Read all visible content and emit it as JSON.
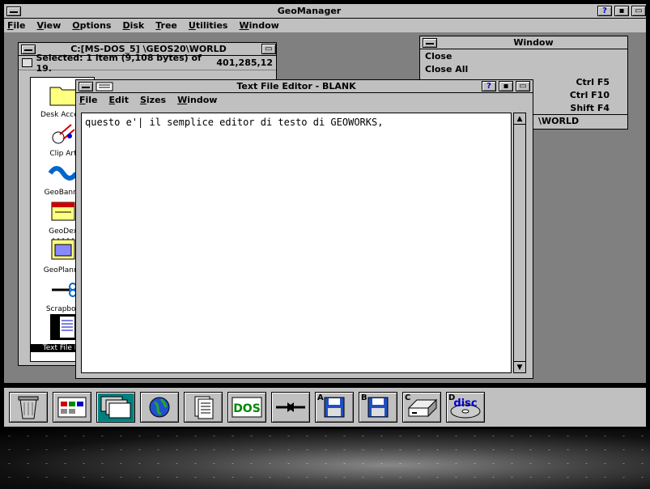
{
  "main": {
    "title": "GeoManager",
    "menu": [
      "File",
      "View",
      "Options",
      "Disk",
      "Tree",
      "Utilities",
      "Window"
    ]
  },
  "folder": {
    "path": "C:[MS-DOS_5] \\GEOS20\\WORLD",
    "status": "Selected: 1 item (9,108 bytes) of 19.",
    "free": "401,285,12",
    "items": [
      {
        "label": "Desk Access",
        "icon": "folder-icon"
      },
      {
        "label": "Clip Art",
        "icon": "clip-art-icon"
      },
      {
        "label": "GeoBanne",
        "icon": "geobanner-icon"
      },
      {
        "label": "GeoDex",
        "icon": "geodex-icon"
      },
      {
        "label": "GeoPlanne",
        "icon": "geoplanner-icon"
      },
      {
        "label": "Scrapboo",
        "icon": "scrapbook-icon"
      },
      {
        "label": "Text File Ed",
        "icon": "text-file-editor-icon"
      }
    ]
  },
  "window_menu": {
    "title": "Window",
    "items": [
      {
        "label": "Close",
        "key": ""
      },
      {
        "label": "Close All",
        "key": ""
      },
      {
        "label": "",
        "key": "Ctrl F5"
      },
      {
        "label": "",
        "key": "Ctrl F10"
      },
      {
        "label": "",
        "key": "Shift F4"
      },
      {
        "label": "\\WORLD",
        "key": ""
      }
    ]
  },
  "editor": {
    "title": "Text File Editor - BLANK",
    "menu": [
      "File",
      "Edit",
      "Sizes",
      "Window"
    ],
    "text": "questo e'| il semplice editor di testo di GEOWORKS,"
  },
  "taskbar": {
    "items": [
      {
        "name": "wastebasket-icon",
        "letter": ""
      },
      {
        "name": "geomanager-icon",
        "letter": ""
      },
      {
        "name": "task-switcher-icon",
        "letter": ""
      },
      {
        "name": "globe-icon",
        "letter": ""
      },
      {
        "name": "documents-icon",
        "letter": ""
      },
      {
        "name": "dos-icon",
        "letter": "",
        "text": "DOS"
      },
      {
        "name": "transfer-icon",
        "letter": ""
      },
      {
        "name": "drive-a-icon",
        "letter": "A"
      },
      {
        "name": "drive-b-icon",
        "letter": "B"
      },
      {
        "name": "drive-c-icon",
        "letter": "C"
      },
      {
        "name": "drive-d-icon",
        "letter": "D",
        "text": "disc"
      }
    ]
  },
  "colors": {
    "desktop": "#808080",
    "chrome": "#c0c0c0",
    "active_task": "#008080"
  }
}
